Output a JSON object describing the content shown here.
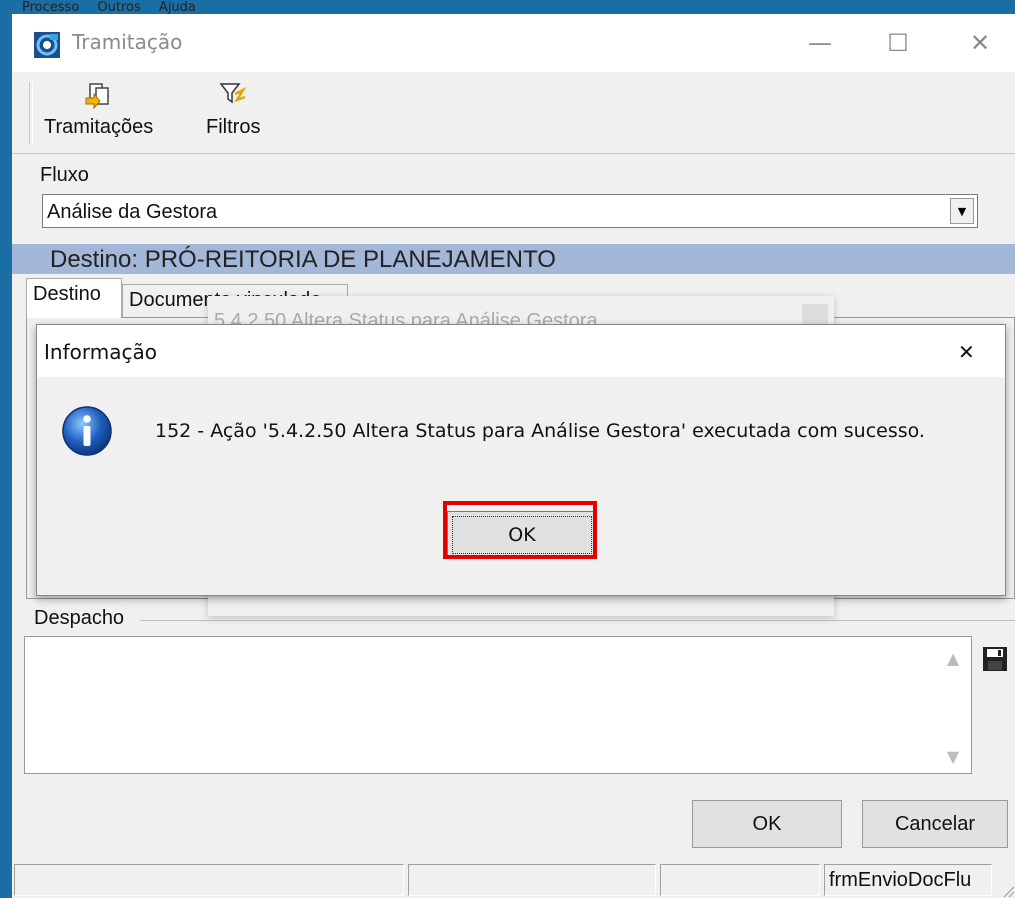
{
  "background_menu": [
    "Processo",
    "Outros",
    "Ajuda"
  ],
  "window": {
    "title": "Tramitação",
    "icon": "app-swirl-icon",
    "controls": {
      "minimize": "—",
      "maximize": "☐",
      "close": "✕"
    }
  },
  "toolbar": {
    "items": [
      {
        "label": "Tramitações",
        "icon": "tramitacoes-icon"
      },
      {
        "label": "Filtros",
        "icon": "filter-icon"
      }
    ]
  },
  "fluxo": {
    "label": "Fluxo",
    "value": "Análise da Gestora"
  },
  "destino_banner": "Destino: PRÓ-REITORIA DE PLANEJAMENTO",
  "tabs": [
    {
      "label": "Destino",
      "active": true
    },
    {
      "label": "Documento vinculado",
      "active": false
    }
  ],
  "background_dialog_title": "5.4.2.50 Altera Status para Análise Gestora",
  "dialog": {
    "title": "Informação",
    "close": "✕",
    "icon": "information-icon",
    "message": "152 - Ação '5.4.2.50 Altera Status para Análise Gestora' executada com sucesso.",
    "ok_label": "OK"
  },
  "despacho": {
    "label": "Despacho",
    "value": ""
  },
  "buttons": {
    "ok": "OK",
    "cancel": "Cancelar"
  },
  "statusbar": {
    "panels": [
      "",
      "",
      "",
      "frmEnvioDocFlu"
    ]
  },
  "colors": {
    "desktop": "#1a6ea4",
    "banner": "#a3b8d8",
    "highlight": "#e60000",
    "info_icon": "#1f5fbf"
  }
}
